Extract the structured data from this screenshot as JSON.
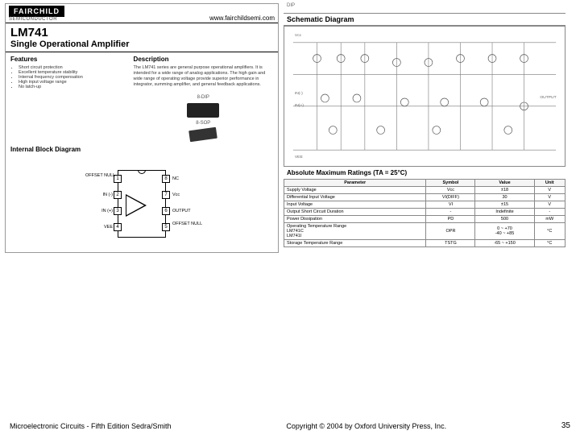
{
  "header": {
    "logo": "FAIRCHILD",
    "logo_sub": "SEMICONDUCTOR",
    "url": "www.fairchildsemi.com"
  },
  "part": {
    "number": "LM741",
    "subtitle": "Single Operational Amplifier"
  },
  "left": {
    "features_head": "Features",
    "features": [
      "Short circuit protection",
      "Excellent temperature stability",
      "Internal frequency compensation",
      "High input voltage range",
      "No latch-up"
    ],
    "desc_head": "Description",
    "desc": "The LM741 series are general purpose operational amplifiers. It is intended for a wide range of analog applications. The high gain and wide range of operating voltage provide superior performance in integrator, summing amplifier, and general feedback applications.",
    "pkg1": "8-DIP",
    "pkg2": "8-SOP",
    "block_head": "Internal Block Diagram",
    "pins": {
      "p1": "1",
      "p1l": "OFFSET NULL",
      "p2": "2",
      "p2l": "IN (-)",
      "p3": "3",
      "p3l": "IN (+)",
      "p4": "4",
      "p4l": "VEE",
      "p5": "5",
      "p5l": "OFFSET NULL",
      "p6": "6",
      "p6l": "OUTPUT",
      "p7": "7",
      "p7l": "Vcc",
      "p8": "8",
      "p8l": "NC"
    }
  },
  "right": {
    "tiny": "DIP",
    "schem_head": "Schematic Diagram",
    "ratings_head": "Absolute Maximum Ratings (TA = 25°C)",
    "cols": {
      "param": "Parameter",
      "sym": "Symbol",
      "val": "Value",
      "unit": "Unit"
    },
    "rows": [
      {
        "param": "Supply Voltage",
        "sym": "Vcc",
        "val": "±18",
        "unit": "V"
      },
      {
        "param": "Differential Input Voltage",
        "sym": "VI(DIFF)",
        "val": "30",
        "unit": "V"
      },
      {
        "param": "Input Voltage",
        "sym": "VI",
        "val": "±15",
        "unit": "V"
      },
      {
        "param": "Output Short Circuit Duration",
        "sym": "-",
        "val": "Indefinite",
        "unit": "-"
      },
      {
        "param": "Power Dissipation",
        "sym": "PD",
        "val": "500",
        "unit": "mW"
      },
      {
        "param": "Operating Temperature Range\nLM741C\nLM741I",
        "sym": "OPR",
        "val": "0 ~ +70\n-40 ~ +85",
        "unit": "°C"
      },
      {
        "param": "Storage Temperature Range",
        "sym": "TSTG",
        "val": "-65 ~ +150",
        "unit": "°C"
      }
    ]
  },
  "footer": {
    "left": "Microelectronic Circuits - Fifth Edition   Sedra/Smith",
    "center": "Copyright © 2004 by Oxford University Press, Inc.",
    "page": "35"
  }
}
